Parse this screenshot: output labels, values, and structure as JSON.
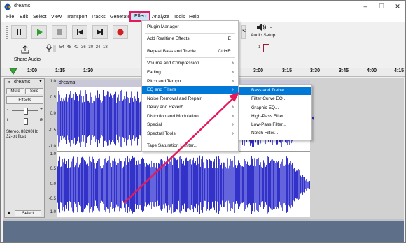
{
  "window": {
    "title": "dreams"
  },
  "menubar": [
    "File",
    "Edit",
    "Select",
    "View",
    "Transport",
    "Tracks",
    "Generate",
    "Effect",
    "Analyze",
    "Tools",
    "Help"
  ],
  "toolbar": {
    "share_label": "Share Audio",
    "audio_setup_label": "Audio Setup",
    "meter_scale": "-54  -48  -42  -36  -30  -24  -18",
    "meter_scale_right": "-1"
  },
  "ruler": {
    "ticks": [
      "1:00",
      "1:15",
      "1:30",
      "3:00",
      "3:15",
      "3:30",
      "3:45",
      "4:00",
      "4:15"
    ]
  },
  "track": {
    "name": "dreams",
    "clip_name": "dreams",
    "mute": "Mute",
    "solo": "Solo",
    "effects": "Effects",
    "gain_minus": "-",
    "gain_plus": "+",
    "pan_left": "L",
    "pan_right": "R",
    "info_line1": "Stereo, 88200Hz",
    "info_line2": "32-bit float",
    "select": "Select",
    "scale_top": [
      "1.0",
      "0.5",
      "0.0",
      "-0.5",
      "-1.0"
    ],
    "scale_bottom": [
      "1.0",
      "0.5",
      "0.0",
      "-0.5",
      "-1.0"
    ]
  },
  "effect_menu": {
    "items": [
      {
        "label": "Plugin Manager",
        "shortcut": "",
        "arrow": ""
      },
      {
        "label": "Add Realtime Effects",
        "shortcut": "E",
        "arrow": ""
      },
      {
        "label": "Repeat Bass and Treble",
        "shortcut": "Ctrl+R",
        "arrow": ""
      },
      {
        "label": "Volume and Compression",
        "shortcut": "",
        "arrow": "›"
      },
      {
        "label": "Fading",
        "shortcut": "",
        "arrow": "›"
      },
      {
        "label": "Pitch and Tempo",
        "shortcut": "",
        "arrow": "›"
      },
      {
        "label": "EQ and Filters",
        "shortcut": "",
        "arrow": "›"
      },
      {
        "label": "Noise Removal and Repair",
        "shortcut": "",
        "arrow": "›"
      },
      {
        "label": "Delay and Reverb",
        "shortcut": "",
        "arrow": "›"
      },
      {
        "label": "Distortion and Modulation",
        "shortcut": "",
        "arrow": "›"
      },
      {
        "label": "Special",
        "shortcut": "",
        "arrow": "›"
      },
      {
        "label": "Spectral Tools",
        "shortcut": "",
        "arrow": "›"
      },
      {
        "label": "Tape Saturation Limiter...",
        "shortcut": "",
        "arrow": ""
      }
    ]
  },
  "eq_submenu": {
    "items": [
      "Bass and Treble...",
      "Filter Curve EQ...",
      "Graphic EQ...",
      "High-Pass Filter...",
      "Low-Pass Filter...",
      "Notch Filter..."
    ]
  },
  "colors": {
    "highlight": "#0078d7",
    "annotation": "#e5195a",
    "waveform": "#3232c8",
    "waveform_light": "#6464dc"
  }
}
